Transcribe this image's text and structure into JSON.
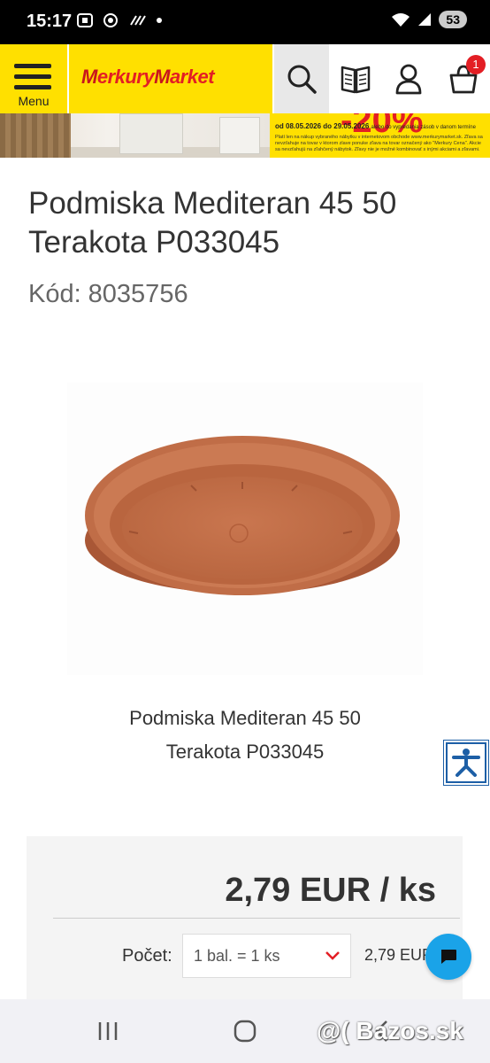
{
  "status_bar": {
    "time": "15:17",
    "notification_icons": [
      "screenshot-icon",
      "chrome-icon",
      "slash-icon",
      "dot-icon"
    ],
    "battery": "53"
  },
  "header": {
    "menu_label": "Menu",
    "logo_text_1": "M",
    "logo_text_2": "erkury",
    "logo_text_3": "M",
    "logo_text_4": "arket",
    "cart_count": "1",
    "colors": {
      "brand_yellow": "#ffe000",
      "brand_red": "#e31e24"
    }
  },
  "banner": {
    "discount": "-20%",
    "date_text": "od 08.05.2026 do 29.05.2026",
    "date_suffix": "alebo do vypredania zásob v danom termíne",
    "fine_print": "Platí len na nákup vybraného nábytku v internetovom obchode www.merkurymarket.sk. Zľava sa nevzťahuje na tovar v ktorom zlave ponuke zľava na tovar označený ako \"Merkury Cena\". Akcie sa nevzťahujú na zľahčený nábytok. Zľavy nie je možné kombinovať s inými akciami a zľavami."
  },
  "product": {
    "title": "Podmiska Mediteran 45 50 Terakota P033045",
    "code_label": "Kód:",
    "code_value": "8035756",
    "caption_line1": "Podmiska Mediteran 45 50",
    "caption_line2": "Terakota P033045"
  },
  "price_box": {
    "price": "2,79 EUR / ks",
    "qty_label": "Počet:",
    "qty_selected": "1 bal. = 1 ks",
    "qty_total": "2,79 EUR"
  },
  "watermark": "@( Bazos.sk"
}
